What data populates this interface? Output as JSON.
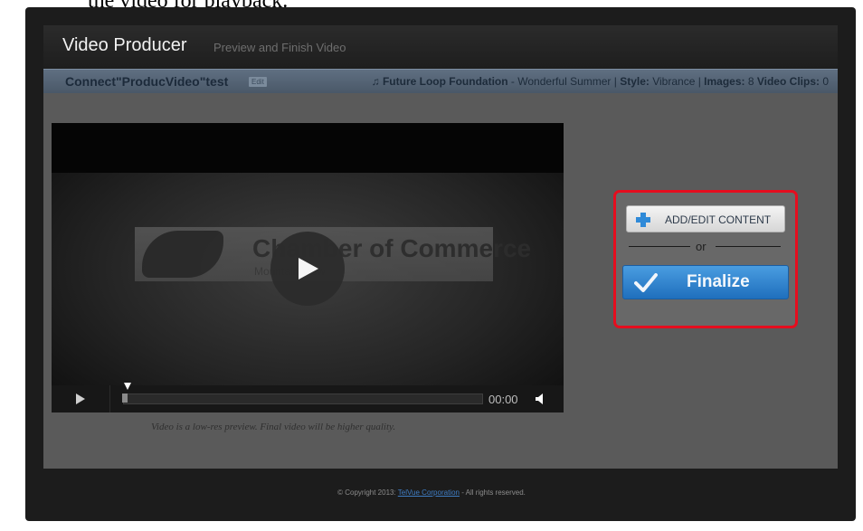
{
  "document": {
    "partial_text": "the video for playback."
  },
  "app": {
    "title": "Video Producer",
    "subtitle": "Preview and Finish Video"
  },
  "infobar": {
    "project_name": "Connect\"ProducVideo\"test",
    "edit_label": "Edit",
    "music_artist": "Future Loop Foundation",
    "music_track": " - Wonderful Summer | ",
    "style_label": "Style:",
    "style_value": " Vibrance | ",
    "images_label": "Images:",
    "images_value": " 8 ",
    "clips_label": "Video Clips:",
    "clips_value": " 0"
  },
  "player": {
    "poster_title": "Chamber of Commerce",
    "poster_subtitle": "Mountain View",
    "time": "00:00",
    "caption": "Video is a low-res preview.  Final video will be higher quality.",
    "progress": 0
  },
  "actions": {
    "add_label": "ADD/EDIT CONTENT",
    "or_label": "or",
    "finalize_label": "Finalize"
  },
  "footer": {
    "prefix": "© Copyright 2013: ",
    "link": "TelVue Corporation",
    "suffix": " - All rights reserved."
  },
  "colors": {
    "highlight": "#e50d1e",
    "finalize": "#2a7fce",
    "accent": "#2f8ad8"
  }
}
